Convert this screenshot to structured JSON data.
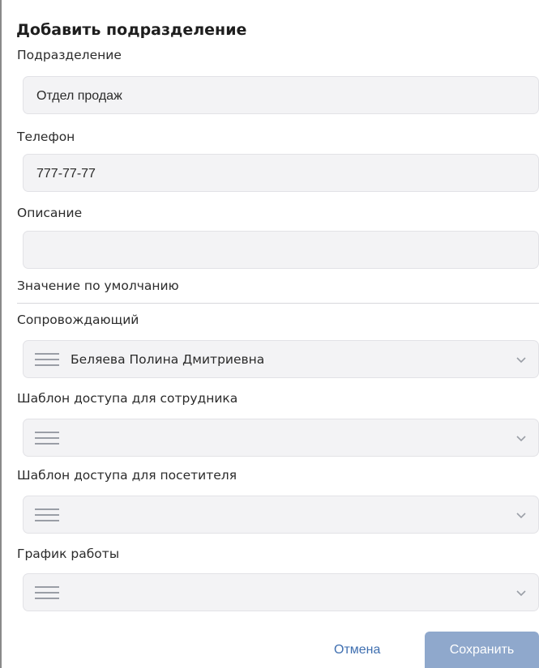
{
  "dialog": {
    "title": "Добавить подразделение"
  },
  "fields": {
    "department": {
      "label": "Подразделение",
      "value": "Отдел продаж"
    },
    "phone": {
      "label": "Телефон",
      "value": "777-77-77"
    },
    "description": {
      "label": "Описание",
      "value": ""
    }
  },
  "defaults_section": {
    "heading": "Значение по умолчанию"
  },
  "selects": {
    "escort": {
      "label": "Сопровождающий",
      "value": "Беляева Полина Дмитриевна",
      "icon": "list-icon"
    },
    "employee_template": {
      "label": "Шаблон доступа для сотрудника",
      "value": "",
      "icon": "list-icon"
    },
    "visitor_template": {
      "label": "Шаблон доступа для посетителя",
      "value": "",
      "icon": "list-icon"
    },
    "schedule": {
      "label": "График работы",
      "value": "",
      "icon": "list-icon"
    }
  },
  "footer": {
    "cancel_label": "Отмена",
    "save_label": "Сохранить"
  },
  "colors": {
    "accent": "#3f6fb0",
    "save_button": "#8fa8cc",
    "field_background": "#f3f3f5"
  }
}
